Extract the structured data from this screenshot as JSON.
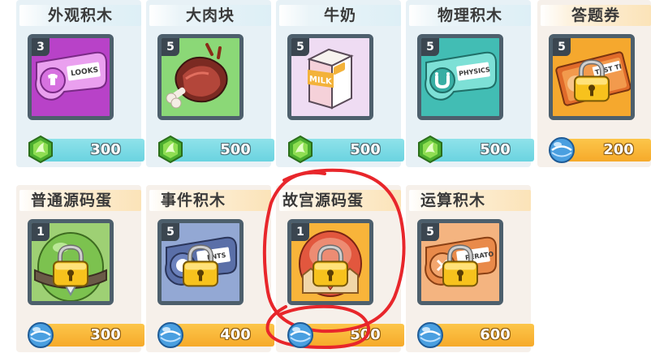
{
  "colors": {
    "card_bg_blue": "#e7f1f6",
    "card_bg_cream": "#f6f0ea",
    "price_bar_teal": "#6ad3e0",
    "price_bar_orange": "#f6aa2a",
    "annotation_red": "#e8262b",
    "level_badge": "#3b4650"
  },
  "items": [
    {
      "title": "外观积木",
      "level": "3",
      "price": "300",
      "currency_icon": "green-gem-icon",
      "locked": false,
      "icon": "looks-block-icon",
      "icon_text": "LOOKS"
    },
    {
      "title": "大肉块",
      "level": "5",
      "price": "500",
      "currency_icon": "green-gem-icon",
      "locked": false,
      "icon": "meat-chunk-icon"
    },
    {
      "title": "牛奶",
      "level": "5",
      "price": "500",
      "currency_icon": "green-gem-icon",
      "locked": false,
      "icon": "milk-carton-icon",
      "icon_text": "MILK"
    },
    {
      "title": "物理积木",
      "level": "5",
      "price": "500",
      "currency_icon": "green-gem-icon",
      "locked": false,
      "icon": "physics-block-icon",
      "icon_text": "PHYSICS"
    },
    {
      "title": "答题券",
      "level": "5",
      "price": "200",
      "currency_icon": "blue-orb-icon",
      "locked": true,
      "icon": "test-ticket-icon",
      "icon_text": "TEST TI"
    },
    {
      "title": "普通源码蛋",
      "level": "1",
      "price": "300",
      "currency_icon": "blue-orb-icon",
      "locked": true,
      "icon": "source-egg-icon"
    },
    {
      "title": "事件积木",
      "level": "5",
      "price": "400",
      "currency_icon": "blue-orb-icon",
      "locked": true,
      "icon": "events-block-icon",
      "icon_text": "ENTS"
    },
    {
      "title": "故宫源码蛋",
      "level": "1",
      "price": "500",
      "currency_icon": "blue-orb-icon",
      "locked": true,
      "icon": "palace-egg-icon"
    },
    {
      "title": "运算积木",
      "level": "5",
      "price": "600",
      "currency_icon": "blue-orb-icon",
      "locked": true,
      "icon": "operator-block-icon",
      "icon_text": "PERATO"
    }
  ]
}
